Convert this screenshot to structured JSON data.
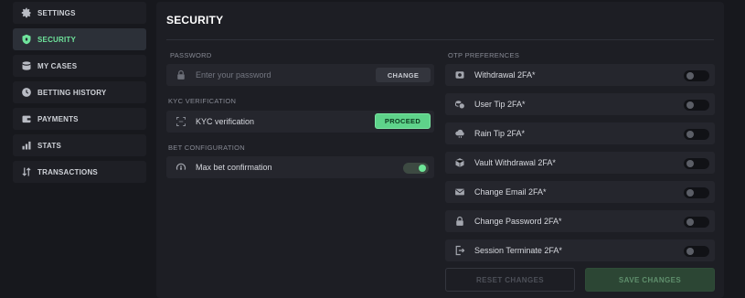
{
  "sidebar": {
    "items": [
      {
        "label": "SETTINGS",
        "icon": "gear-icon"
      },
      {
        "label": "SECURITY",
        "icon": "shield-icon",
        "active": true
      },
      {
        "label": "MY CASES",
        "icon": "cases-icon"
      },
      {
        "label": "BETTING HISTORY",
        "icon": "clock-icon"
      },
      {
        "label": "PAYMENTS",
        "icon": "wallet-icon"
      },
      {
        "label": "STATS",
        "icon": "bar-chart-icon"
      },
      {
        "label": "TRANSACTIONS",
        "icon": "transfer-icon"
      }
    ]
  },
  "main": {
    "title": "SECURITY",
    "password": {
      "section_label": "PASSWORD",
      "placeholder": "Enter your password",
      "value": "",
      "button_label": "CHANGE"
    },
    "kyc": {
      "section_label": "KYC VERIFICATION",
      "label": "KYC verification",
      "button_label": "PROCEED"
    },
    "bet": {
      "section_label": "BET CONFIGURATION",
      "label": "Max bet confirmation",
      "enabled": true
    },
    "otp": {
      "section_label": "OTP PREFERENCES",
      "items": [
        {
          "label": "Withdrawal 2FA*",
          "icon": "withdrawal-icon",
          "enabled": false
        },
        {
          "label": "User Tip 2FA*",
          "icon": "coins-icon",
          "enabled": false
        },
        {
          "label": "Rain Tip 2FA*",
          "icon": "cloud-icon",
          "enabled": false
        },
        {
          "label": "Vault Withdrawal 2FA*",
          "icon": "vault-icon",
          "enabled": false
        },
        {
          "label": "Change Email 2FA*",
          "icon": "mail-icon",
          "enabled": false
        },
        {
          "label": "Change Password 2FA*",
          "icon": "lock-icon",
          "enabled": false
        },
        {
          "label": "Session Terminate 2FA*",
          "icon": "logout-icon",
          "enabled": false
        }
      ]
    },
    "reset_label": "RESET CHANGES",
    "save_label": "SAVE CHANGES"
  },
  "colors": {
    "accent": "#6fe49c",
    "background": "#17181d",
    "panel": "#1d1e24",
    "row": "#25262d"
  }
}
